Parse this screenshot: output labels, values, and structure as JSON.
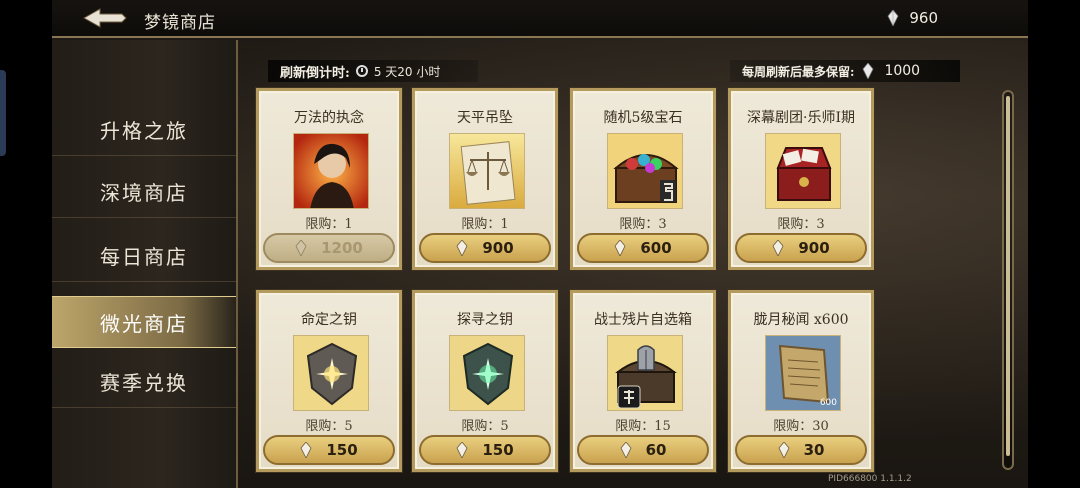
{
  "header": {
    "title": "梦镜商店",
    "currency_value": "960"
  },
  "sidebar": {
    "items": [
      {
        "label": "升格之旅"
      },
      {
        "label": "深境商店"
      },
      {
        "label": "每日商店"
      },
      {
        "label": "微光商店"
      },
      {
        "label": "赛季兑换"
      }
    ],
    "active_index": 3
  },
  "refresh": {
    "label": "刷新倒计时:",
    "time": "5 天20 小时"
  },
  "max_keep": {
    "label": "每周刷新后最多保留:",
    "value": "1000"
  },
  "items": [
    {
      "name": "万法的执念",
      "limit": "限购：1",
      "price": "1200",
      "disabled": true,
      "icon": "portrait-icon"
    },
    {
      "name": "天平吊坠",
      "limit": "限购：1",
      "price": "900",
      "disabled": false,
      "icon": "scales-pendant-icon"
    },
    {
      "name": "随机5级宝石",
      "limit": "限购：3",
      "price": "600",
      "disabled": false,
      "icon": "treasure-chest-icon"
    },
    {
      "name": "深幕剧团·乐师I期",
      "limit": "限购：3",
      "price": "900",
      "disabled": false,
      "icon": "red-chest-icon"
    },
    {
      "name": "命定之钥",
      "limit": "限购：5",
      "price": "150",
      "disabled": false,
      "icon": "golden-shield-icon"
    },
    {
      "name": "探寻之钥",
      "limit": "限购：5",
      "price": "150",
      "disabled": false,
      "icon": "green-shield-icon"
    },
    {
      "name": "战士残片自选箱",
      "limit": "限购：15",
      "price": "60",
      "disabled": false,
      "icon": "helmet-chest-icon"
    },
    {
      "name": "胧月秘闻 x600",
      "limit": "限购：30",
      "price": "30",
      "disabled": false,
      "icon": "scroll-icon",
      "badge": "600"
    }
  ],
  "version": "PID666800  1.1.1.2",
  "colors": {
    "accent_gold": "#c9a24f",
    "card_bg": "#efe9d9",
    "sidebar_active": "#bda66b"
  }
}
